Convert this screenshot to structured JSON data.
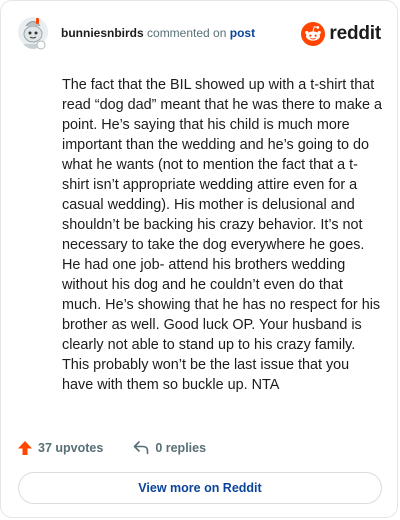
{
  "header": {
    "username": "bunniesnbirds",
    "action_text": "commented on",
    "post_link": "post",
    "brand_name": "reddit"
  },
  "comment": {
    "body": "The fact that the BIL showed up with a t-shirt that read “dog dad” meant that he was there to make a point. He’s saying that his child is much more important than the wedding and he’s going to do what he wants (not to mention the fact that a t-shirt isn’t appropriate wedding attire even for a casual wedding). His mother is delusional and shouldn’t be backing his crazy behavior. It’s not necessary to take the dog everywhere he goes. He had one job- attend his brothers wedding without his dog and he couldn’t even do that much. He’s showing that he has no respect for his brother as well. Good luck OP. Your husband is clearly not able to stand up to his crazy family. This probably won’t be the last issue that you have with them so buckle up. NTA"
  },
  "footer": {
    "upvotes_label": "37 upvotes",
    "replies_label": "0 replies",
    "view_more_label": "View more on Reddit"
  },
  "icons": {
    "upvote": "upvote-arrow-icon",
    "reply": "reply-arrow-icon",
    "brand": "reddit-alien-icon"
  },
  "colors": {
    "brand_orange": "#ff4500",
    "link_blue": "#0a449b",
    "muted_text": "#576f76"
  }
}
